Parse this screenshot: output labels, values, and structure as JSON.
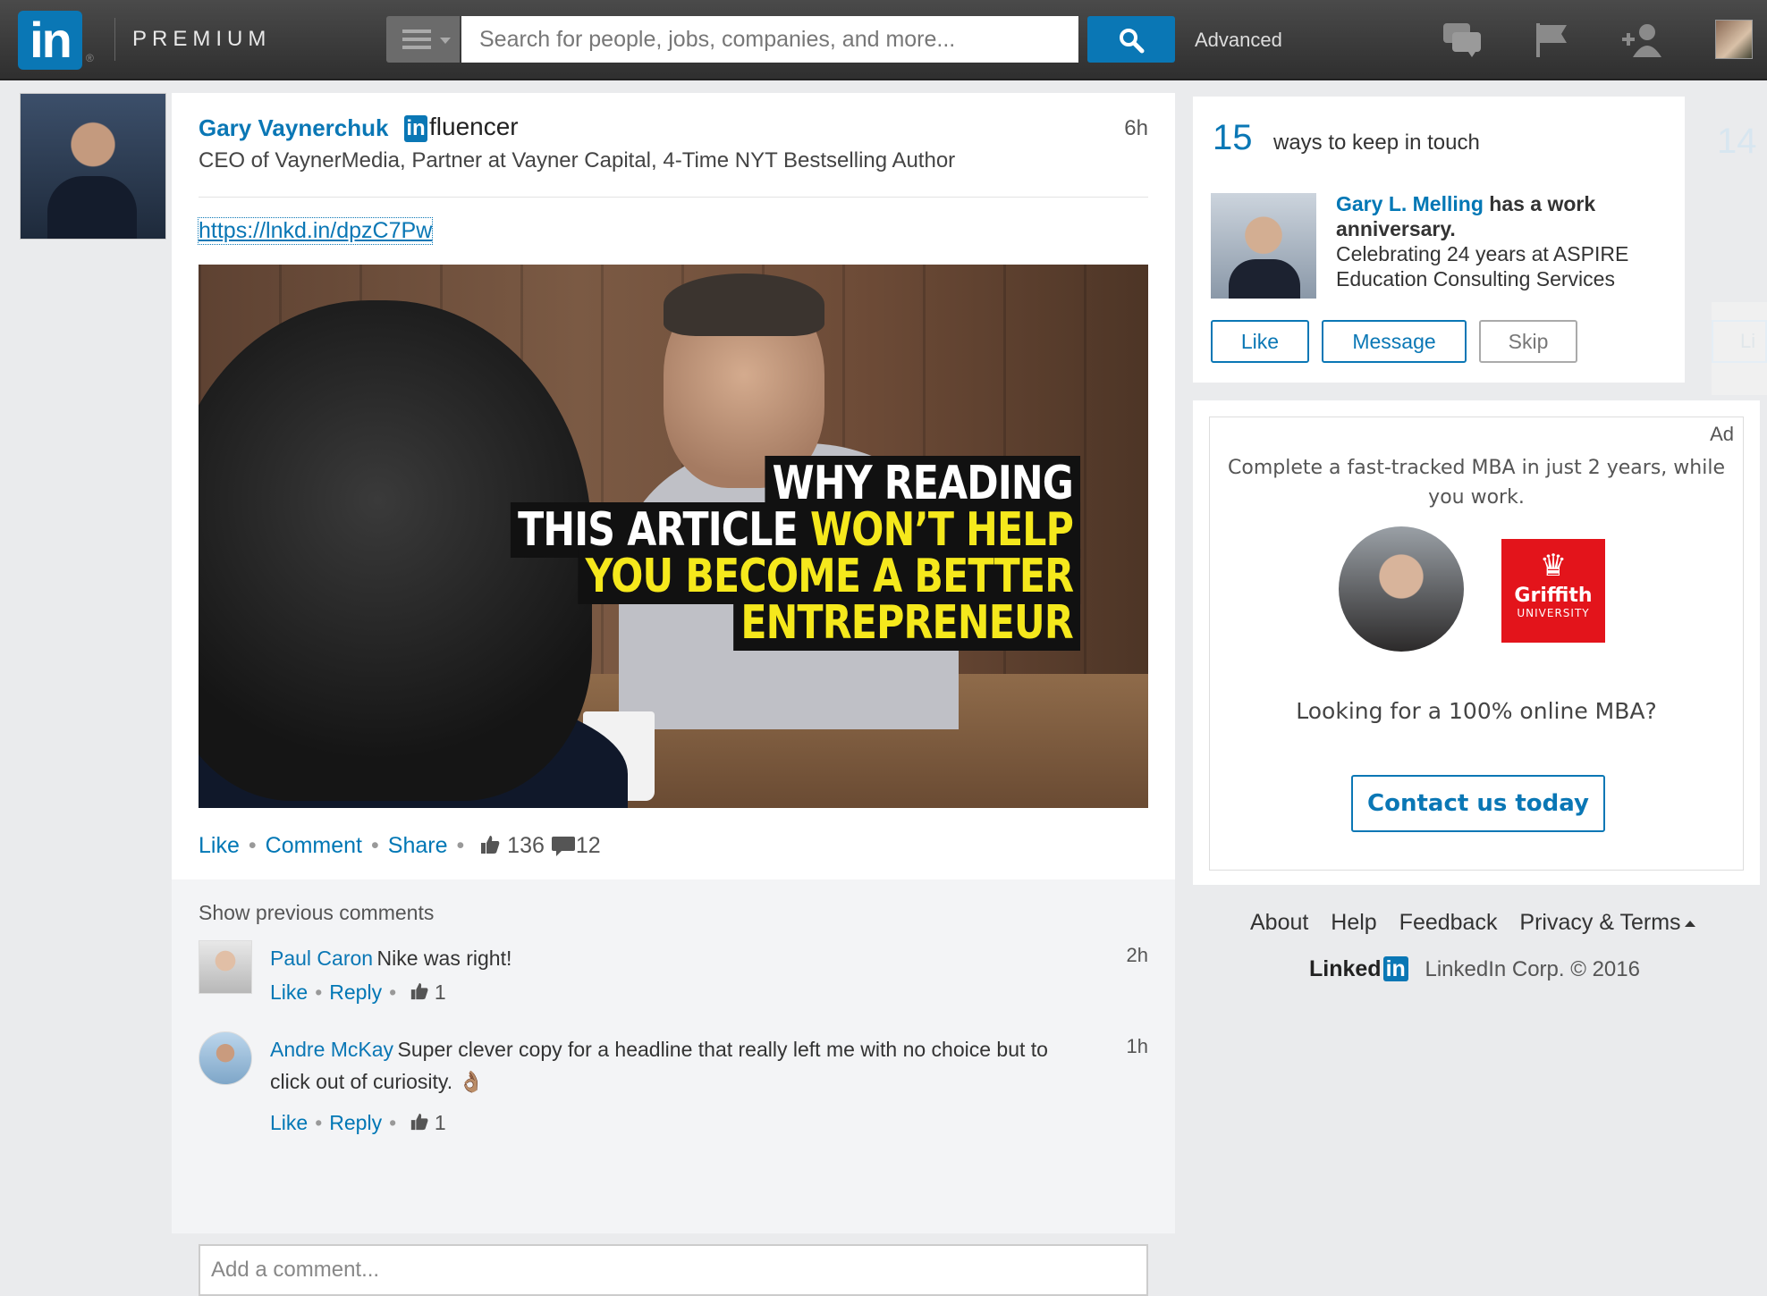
{
  "header": {
    "logo_text": "in",
    "logo_mark": "®",
    "product": "PREMIUM",
    "search_placeholder": "Search for people, jobs, companies, and more...",
    "advanced_label": "Advanced",
    "icons": [
      "menu-icon",
      "search-icon",
      "messages-icon",
      "flag-icon",
      "add-connection-icon",
      "profile-avatar"
    ]
  },
  "post": {
    "author_name": "Gary Vaynerchuk",
    "badge_prefix": "in",
    "badge_suffix": "fluencer",
    "headline": "CEO of VaynerMedia, Partner at Vayner Capital, 4-Time NYT Bestselling Author",
    "time": "6h",
    "link": "https://lnkd.in/dpzC7Pw",
    "image_caption": {
      "line1": "WHY READING",
      "line2_white": "THIS ARTICLE ",
      "line2_yellow": "WON’T HELP",
      "line3": "YOU BECOME A BETTER",
      "line4": "ENTREPRENEUR"
    },
    "actions": {
      "like": "Like",
      "comment": "Comment",
      "share": "Share",
      "likes_count": "136",
      "comments_count": "12"
    }
  },
  "comments": {
    "show_previous": "Show previous comments",
    "items": [
      {
        "name": "Paul Caron",
        "text": "Nike was right!",
        "time": "2h",
        "like": "Like",
        "reply": "Reply",
        "likes": "1"
      },
      {
        "name": "Andre McKay",
        "text": "Super clever copy for a headline that really left me with no choice but to click out of curiosity. 👌🏽",
        "time": "1h",
        "like": "Like",
        "reply": "Reply",
        "likes": "1"
      }
    ],
    "add_placeholder": "Add a comment..."
  },
  "keep_in_touch": {
    "count": "15",
    "title": "ways to keep in touch",
    "person": "Gary L. Melling",
    "event": "has a work anniversary.",
    "detail": "Celebrating 24 years at ASPIRE Education Consulting Services",
    "like": "Like",
    "message": "Message",
    "skip": "Skip",
    "next_count": "14",
    "next_button": "Li"
  },
  "ad": {
    "tag": "Ad",
    "copy": "Complete a fast-tracked MBA in just 2 years, while you work.",
    "logo_name": "Griffith",
    "logo_sub": "UNIVERSITY",
    "question": "Looking for a 100% online MBA?",
    "cta": "Contact us today"
  },
  "footer": {
    "links": [
      "About",
      "Help",
      "Feedback",
      "Privacy & Terms"
    ],
    "brand_text": "Linked",
    "brand_in": "in",
    "copyright": "LinkedIn Corp. © 2016"
  },
  "colors": {
    "brand_blue": "#0a77b5",
    "caption_yellow": "#f5e81c",
    "griffith_red": "#e3141b"
  }
}
